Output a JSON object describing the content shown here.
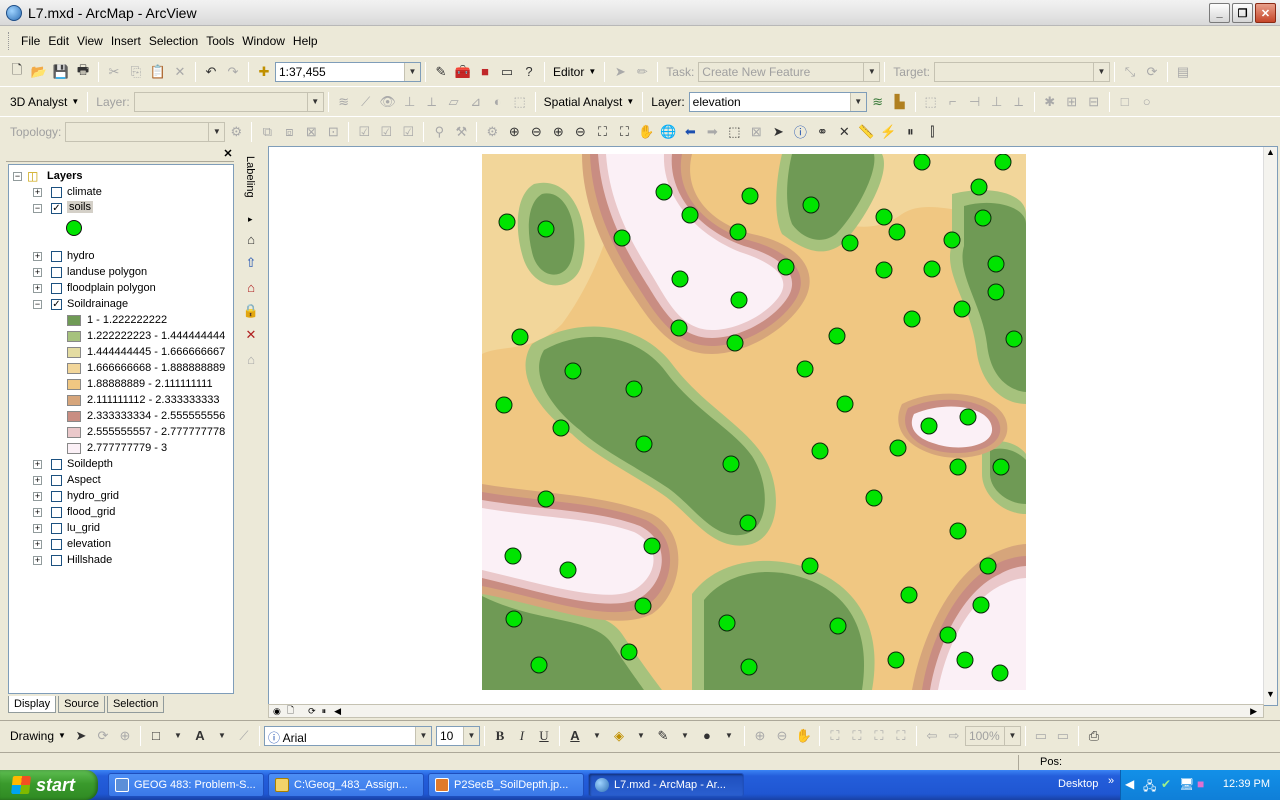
{
  "window": {
    "title": "L7.mxd - ArcMap - ArcView"
  },
  "menu": [
    "File",
    "Edit",
    "View",
    "Insert",
    "Selection",
    "Tools",
    "Window",
    "Help"
  ],
  "standard_toolbar": {
    "scale": "1:37,455",
    "editor_label": "Editor",
    "task_label": "Task:",
    "task_value": "Create New Feature",
    "target_label": "Target:"
  },
  "analyst_toolbar": {
    "analyst3d": "3D Analyst",
    "layer_label": "Layer:",
    "spatial_analyst": "Spatial Analyst",
    "sa_layer_label": "Layer:",
    "sa_layer_value": "elevation"
  },
  "topology_toolbar": {
    "label": "Topology:"
  },
  "toc": {
    "root": "Layers",
    "layers": [
      {
        "name": "climate",
        "checked": false,
        "expanded": false
      },
      {
        "name": "soils",
        "checked": true,
        "expanded": true
      },
      {
        "name": "hydro",
        "checked": false,
        "expanded": false
      },
      {
        "name": "landuse polygon",
        "checked": false,
        "expanded": false
      },
      {
        "name": "floodplain polygon",
        "checked": false,
        "expanded": false
      },
      {
        "name": "Soildrainage",
        "checked": true,
        "expanded": true
      },
      {
        "name": "Soildepth",
        "checked": false,
        "expanded": false
      },
      {
        "name": "Aspect",
        "checked": false,
        "expanded": false
      },
      {
        "name": "hydro_grid",
        "checked": false,
        "expanded": false
      },
      {
        "name": "flood_grid",
        "checked": false,
        "expanded": false
      },
      {
        "name": "lu_grid",
        "checked": false,
        "expanded": false
      },
      {
        "name": "elevation",
        "checked": false,
        "expanded": false
      },
      {
        "name": "Hillshade",
        "checked": false,
        "expanded": false
      }
    ],
    "soils_symbol_color": "#00e400",
    "legend": [
      {
        "label": "1 - 1.222222222",
        "color": "#6f9a55"
      },
      {
        "label": "1.222222223 - 1.444444444",
        "color": "#a6c27d"
      },
      {
        "label": "1.444444445 - 1.666666667",
        "color": "#e4dca2"
      },
      {
        "label": "1.666666668 - 1.888888889",
        "color": "#f2d69a"
      },
      {
        "label": "1.88888889 - 2.111111111",
        "color": "#f0c782"
      },
      {
        "label": "2.111111112 - 2.333333333",
        "color": "#d6a57b"
      },
      {
        "label": "2.333333334 - 2.555555556",
        "color": "#c98d82"
      },
      {
        "label": "2.555555557 - 2.777777778",
        "color": "#eac8ca"
      },
      {
        "label": "2.777777779 - 3",
        "color": "#fbf0f6"
      }
    ],
    "tabs": [
      "Display",
      "Source",
      "Selection"
    ]
  },
  "labeling": "Labeling",
  "drawing_toolbar": {
    "drawing": "Drawing",
    "font": "Arial",
    "size": "10",
    "zoom": "100%"
  },
  "status": {
    "pos_label": "Pos:"
  },
  "taskbar": {
    "start": "start",
    "tasks": [
      "GEOG 483: Problem-S...",
      "C:\\Geog_483_Assign...",
      "P2SecB_SoilDepth.jp...",
      "L7.mxd - ArcMap - Ar..."
    ],
    "desktop": "Desktop",
    "clock": "12:39 PM"
  }
}
